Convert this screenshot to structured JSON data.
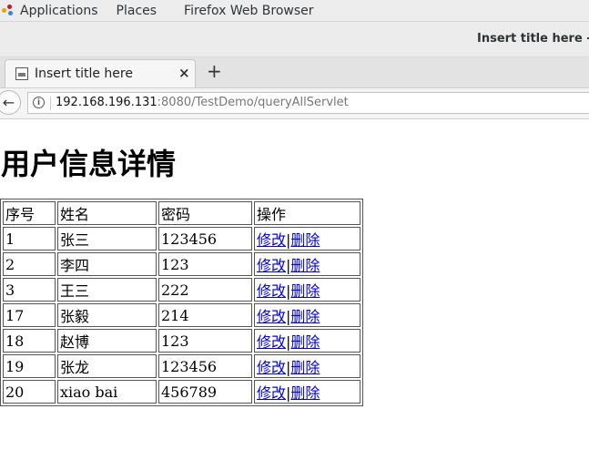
{
  "topbar": {
    "applications": "Applications",
    "places": "Places",
    "app_name": "Firefox Web Browser"
  },
  "window": {
    "title": "Insert title here - Mozilla Firefox"
  },
  "tabs": [
    {
      "title": "Insert title here",
      "close": "×"
    }
  ],
  "newtab_label": "+",
  "navbar": {
    "back": "←",
    "url_host": "192.168.196.131",
    "url_rest": ":8080/TestDemo/queryAllServlet"
  },
  "page": {
    "heading": "用户信息详情",
    "columns": [
      "序号",
      "姓名",
      "密码",
      "操作"
    ],
    "edit_label": "修改",
    "sep": "|",
    "delete_label": "删除",
    "rows": [
      {
        "id": "1",
        "name": "张三",
        "password": "123456"
      },
      {
        "id": "2",
        "name": "李四",
        "password": "123"
      },
      {
        "id": "3",
        "name": "王三",
        "password": "222"
      },
      {
        "id": "17",
        "name": "张毅",
        "password": "214"
      },
      {
        "id": "18",
        "name": "赵博",
        "password": "123"
      },
      {
        "id": "19",
        "name": "张龙",
        "password": "123456"
      },
      {
        "id": "20",
        "name": "xiao bai",
        "password": "456789"
      }
    ]
  }
}
